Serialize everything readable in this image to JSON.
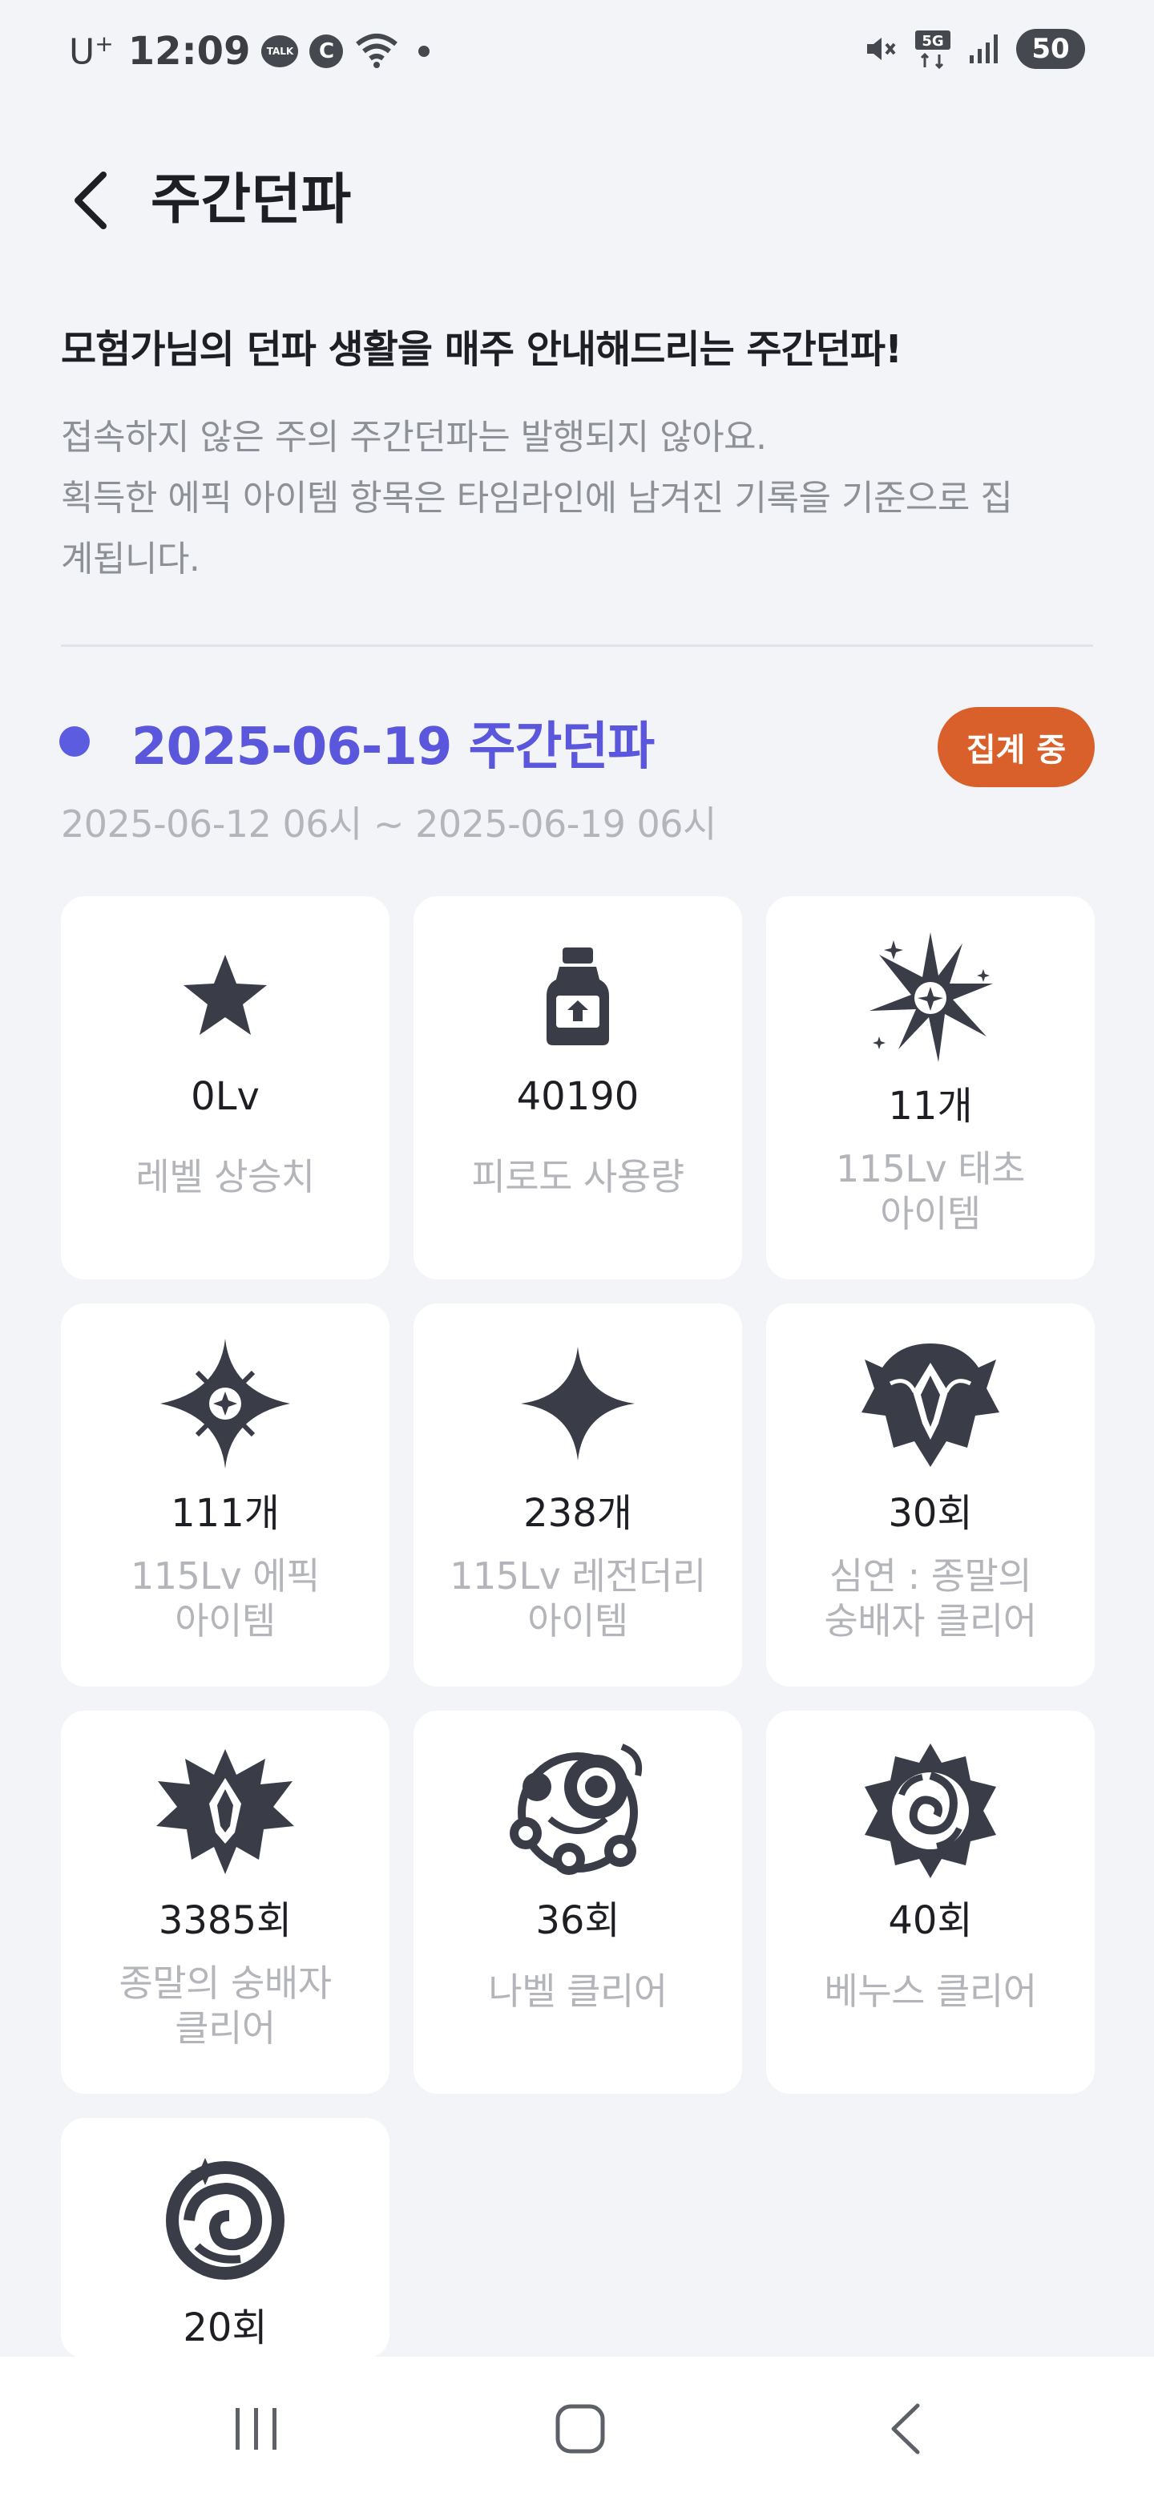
{
  "status_bar": {
    "carrier": "U",
    "carrier_sup": "+",
    "time": "12:09",
    "talk_icon_text": "TALK",
    "c_icon_text": "C",
    "network": "5G",
    "battery": "50"
  },
  "header": {
    "title": "주간던파"
  },
  "intro": {
    "title": "모험가님의 던파 생활을 매주 안내해드리는 주간던파!",
    "desc_line1": "접속하지 않은 주의 주간던파는 발행되지 않아요.",
    "desc_line2": "획득한 에픽 아이템 항목은 타임라인에 남겨진 기록을 기준으로 집",
    "desc_line3": "계됩니다."
  },
  "week": {
    "title": "2025-06-19 주간던파",
    "badge": "집계 중",
    "range": "2025-06-12 06시 ~ 2025-06-19 06시"
  },
  "cards": [
    {
      "icon": "star-icon",
      "value": "0Lv",
      "label_line1": "레벨 상승치",
      "label_line2": ""
    },
    {
      "icon": "potion-bottle-icon",
      "value": "40190",
      "label_line1": "피로도 사용량",
      "label_line2": ""
    },
    {
      "icon": "burst-star-icon",
      "value": "11개",
      "label_line1": "115Lv 태초",
      "label_line2": "아이템"
    },
    {
      "icon": "sparkle-star-icon",
      "value": "111개",
      "label_line1": "115Lv 에픽",
      "label_line2": "아이템"
    },
    {
      "icon": "four-point-star-icon",
      "value": "238개",
      "label_line1": "115Lv 레전더리",
      "label_line2": "아이템"
    },
    {
      "icon": "abyss-emblem-icon",
      "value": "30회",
      "label_line1": "심연 : 종말의",
      "label_line2": "숭배자 클리어"
    },
    {
      "icon": "cultist-emblem-icon",
      "value": "3385회",
      "label_line1": "종말의 숭배자",
      "label_line2": "클리어"
    },
    {
      "icon": "nabel-emblem-icon",
      "value": "36회",
      "label_line1": "나벨 클리어",
      "label_line2": ""
    },
    {
      "icon": "venus-emblem-icon",
      "value": "40회",
      "label_line1": "베누스 클리어",
      "label_line2": ""
    },
    {
      "icon": "swirl-emblem-icon",
      "value": "20회",
      "label_line1": "",
      "label_line2": ""
    }
  ],
  "colors": {
    "accent": "#5b57dd",
    "badge": "#d9602a",
    "background": "#f3f4f7",
    "icon": "#3a3c48"
  }
}
